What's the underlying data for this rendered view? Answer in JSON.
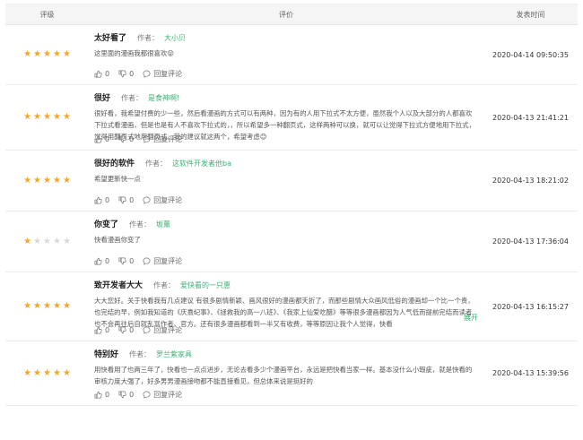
{
  "header": {
    "rating": "评级",
    "review": "评价",
    "time": "发表时间"
  },
  "author_label": "作者：",
  "reply_label": "回复评论",
  "colors": {
    "accent": "#3bb273",
    "star": "#f5a623"
  },
  "reviews": [
    {
      "title": "太好看了",
      "author": "大小贝",
      "stars": 5,
      "body": "这里面的漫画我都很喜欢😝",
      "likes": "0",
      "dislikes": "0",
      "time": "2020-04-14 09:50:35"
    },
    {
      "title": "很好",
      "author": "是食神啊!",
      "stars": 5,
      "body": "很好看，我希望付费的少一些，然后看漫画的方式可以有两种，因为有的人用下拉式不太方便，虽然我个人以及大部分的人都喜欢下拉式看漫画，但是也是有人不喜欢下拉式的，，所以希望多一种翻页式，这样两种可以换，就可以让觉得下拉式方便地用下拉式，觉得用翻页式地用翻页式。我的建议就这两个，希望考虑😊",
      "likes": "0",
      "dislikes": "0",
      "time": "2020-04-13 21:41:21"
    },
    {
      "title": "很好的软件",
      "author": "这软件开发者他ba",
      "stars": 5,
      "body": "希望更新快一点",
      "likes": "0",
      "dislikes": "0",
      "time": "2020-04-13 18:21:02"
    },
    {
      "title": "你变了",
      "author": "坂薰",
      "stars": 1,
      "body": "快看漫画你变了",
      "likes": "0",
      "dislikes": "0",
      "time": "2020-04-13 17:36:04"
    },
    {
      "title": "致开发者大大",
      "author": "爱快看的一只惠",
      "stars": 5,
      "body": "大大您好。关于快看我有几点建议 有很多剧情新颖、画风很好的漫画都夭折了，而那些剧情大众画风低俗的漫画却一个比一个贵，也完结的早，例如我知道的《庆熹纪事》、《拯救我的高一八班》、《我家上仙爱吃醋》等等很多漫画都因为人气低而提前完结而读者也不会再往后自就乱骂作者、官方。还有很多漫画都看到一半又有收费，等等原因让我个人觉得，快看",
      "expand": "展开",
      "likes": "0",
      "dislikes": "0",
      "time": "2020-04-13 16:15:27"
    },
    {
      "title": "特别好",
      "author": "罗兰紫家具",
      "stars": 5,
      "body": "用快看用了也两三年了，快看也一点点进步，无论去看多少个漫画平台，永远是把快看当家一样。基本没什么小瑕疵，就是快看的审核力度大强了，好多男男漫画接吻都不能直接看见，但总体来说是挺好的",
      "likes": "0",
      "dislikes": "0",
      "time": "2020-04-13 15:39:56"
    }
  ]
}
